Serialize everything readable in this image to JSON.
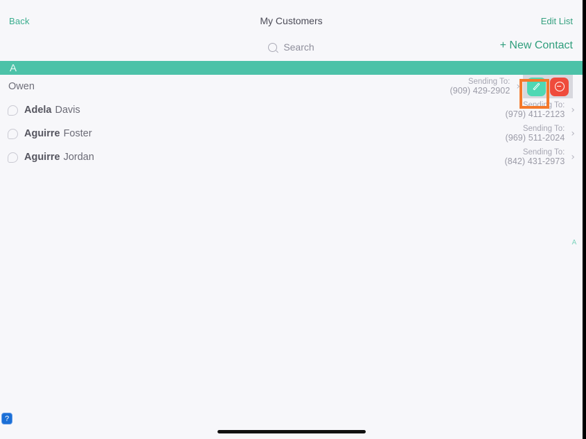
{
  "navbar": {
    "back_label": "Back",
    "title": "My Customers",
    "edit_label": "Edit List"
  },
  "search": {
    "placeholder": "Search",
    "value": "",
    "icon": "search-icon"
  },
  "new_contact_label": "+ New Contact",
  "section": {
    "letter": "A"
  },
  "side_index": {
    "letters": "A"
  },
  "contacts": [
    {
      "first_name": "",
      "last_name": "Owen",
      "has_avatar": false,
      "sending_label": "Sending To:",
      "phone": "(909) 429-2902",
      "editing": true,
      "edit_icon": "pencil-icon",
      "delete_icon": "minus-circle-icon",
      "chevron": "›"
    },
    {
      "first_name": "Adela",
      "last_name": "Davis",
      "has_avatar": true,
      "sending_label": "Sending To:",
      "phone": "(979) 411-2123",
      "editing": false,
      "chevron": "›"
    },
    {
      "first_name": "Aguirre",
      "last_name": "Foster",
      "has_avatar": true,
      "sending_label": "Sending To:",
      "phone": "(969) 511-2024",
      "editing": false,
      "chevron": "›"
    },
    {
      "first_name": "Aguirre",
      "last_name": "Jordan",
      "has_avatar": true,
      "sending_label": "Sending To:",
      "phone": "(842) 431-2973",
      "editing": false,
      "chevron": "›"
    }
  ],
  "help_badge": {
    "label": "?"
  },
  "colors": {
    "accent_teal": "#4cc2a8",
    "link_green": "#34a07f",
    "edit_button": "#4ed8b4",
    "delete_button": "#ef4b3c",
    "highlight": "#f4792b",
    "background": "#f7f7fa",
    "help_blue": "#1b6fd6"
  }
}
